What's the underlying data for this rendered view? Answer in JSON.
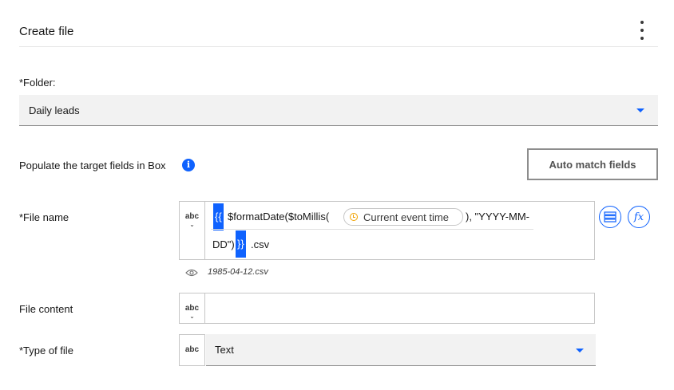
{
  "header": {
    "title": "Create file"
  },
  "folder": {
    "label": "*Folder:",
    "value": "Daily leads"
  },
  "populate": {
    "text": "Populate the target fields in Box",
    "info_glyph": "i",
    "auto_match_label": "Auto match fields"
  },
  "file_name": {
    "label": "*File name",
    "type_badge": "abc",
    "open_brace": "{{",
    "expr_part1": "$formatDate($toMillis(",
    "pill_label": "Current event time",
    "expr_part2": "), \"YYYY-MM-",
    "expr_part3": "DD\")",
    "close_brace": "}}",
    "suffix": ".csv",
    "preview": "1985-04-12.csv",
    "fx_glyph": "fx"
  },
  "file_content": {
    "label": "File content",
    "type_badge": "abc"
  },
  "type_of_file": {
    "label": "*Type of file",
    "type_badge": "abc",
    "value": "Text"
  },
  "colors": {
    "accent": "#0f62fe",
    "field_bg": "#f2f2f2",
    "border": "#c6c6c6",
    "clock": "#f1a200"
  }
}
